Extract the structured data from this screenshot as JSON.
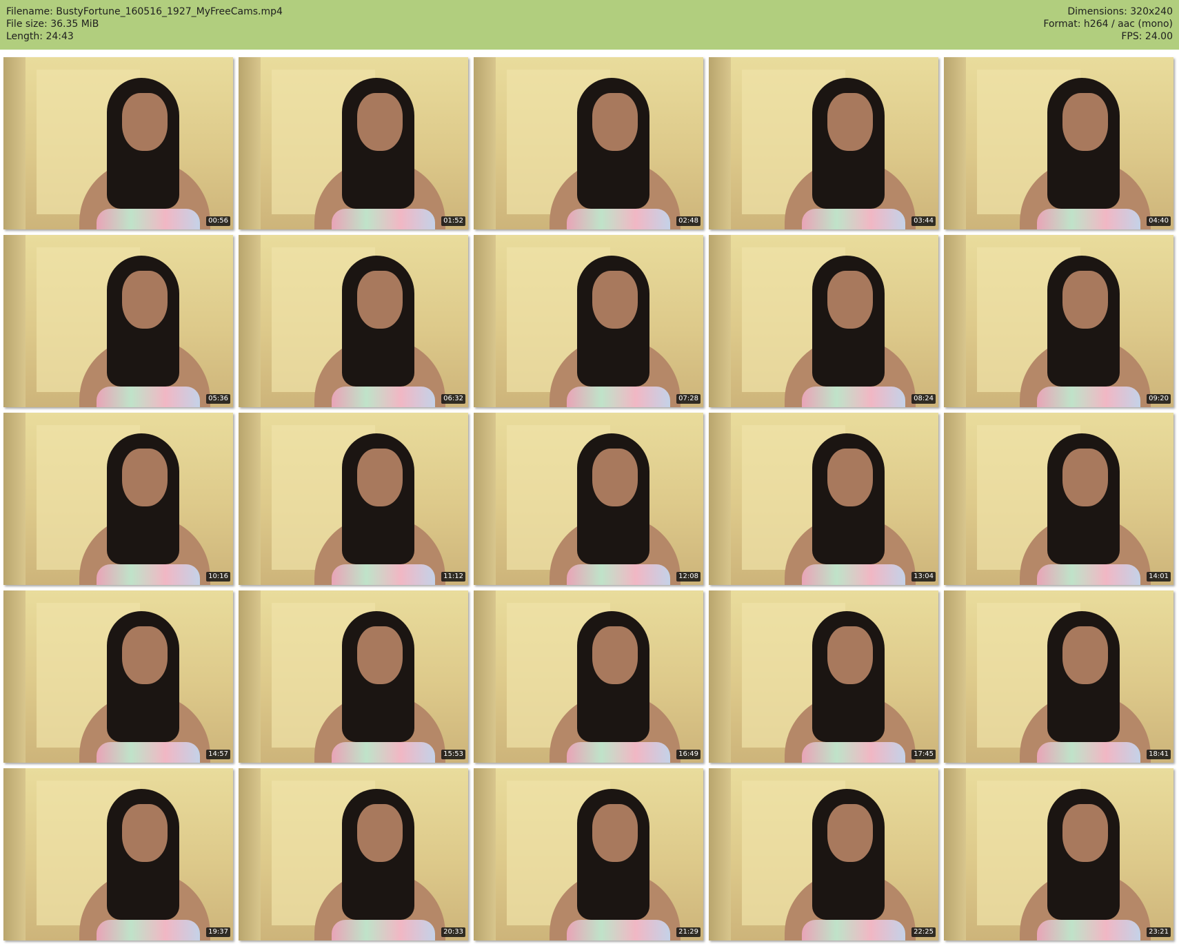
{
  "header": {
    "filename": "Filename: BustyFortune_160516_1927_MyFreeCams.mp4",
    "filesize": "File size: 36.35 MiB",
    "length": "Length: 24:43",
    "dimensions": "Dimensions: 320x240",
    "format": "Format: h264 / aac (mono)",
    "fps": "FPS: 24.00"
  },
  "colors": {
    "header_bg": "#b1ce7e",
    "timestamp_bg": "#141414"
  },
  "thumbnails": [
    {
      "time": "00:56"
    },
    {
      "time": "01:52"
    },
    {
      "time": "02:48"
    },
    {
      "time": "03:44"
    },
    {
      "time": "04:40"
    },
    {
      "time": "05:36"
    },
    {
      "time": "06:32"
    },
    {
      "time": "07:28"
    },
    {
      "time": "08:24"
    },
    {
      "time": "09:20"
    },
    {
      "time": "10:16"
    },
    {
      "time": "11:12"
    },
    {
      "time": "12:08"
    },
    {
      "time": "13:04"
    },
    {
      "time": "14:01"
    },
    {
      "time": "14:57"
    },
    {
      "time": "15:53"
    },
    {
      "time": "16:49"
    },
    {
      "time": "17:45"
    },
    {
      "time": "18:41"
    },
    {
      "time": "19:37"
    },
    {
      "time": "20:33"
    },
    {
      "time": "21:29"
    },
    {
      "time": "22:25"
    },
    {
      "time": "23:21"
    }
  ]
}
